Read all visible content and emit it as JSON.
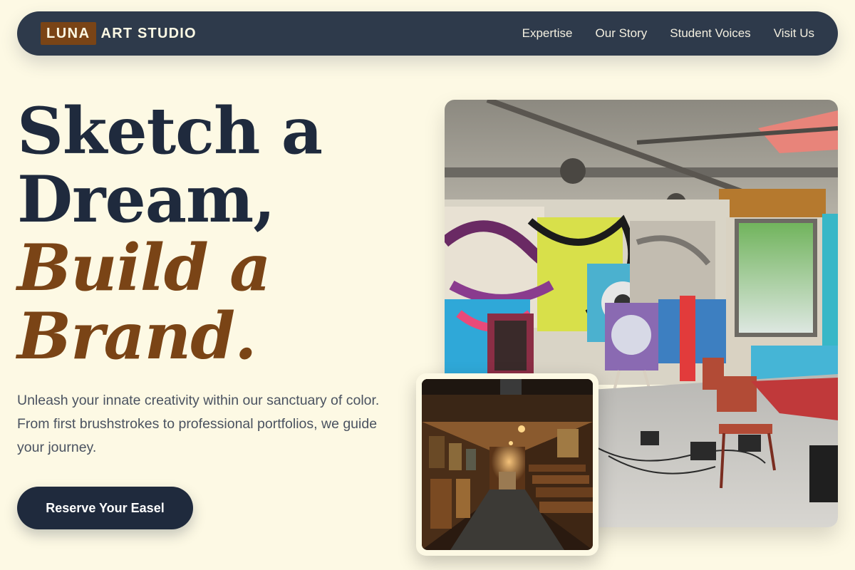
{
  "brand": {
    "logo_box": "LUNA",
    "logo_rest": "ART STUDIO"
  },
  "nav": {
    "items": [
      {
        "label": "Expertise"
      },
      {
        "label": "Our Story"
      },
      {
        "label": "Student Voices"
      },
      {
        "label": "Visit Us"
      }
    ]
  },
  "hero": {
    "line1": "Sketch a",
    "line2": "Dream,",
    "line3": "Build a",
    "line4": "Brand.",
    "description": "Unleash your innate creativity within our sanctuary of color. From first brushstrokes to professional portfolios, we guide your journey.",
    "cta_label": "Reserve Your Easel"
  },
  "images": {
    "main": "studio-graffiti-photo",
    "inset": "gallery-hallway-photo"
  },
  "colors": {
    "background": "#fdf9e4",
    "navy": "#1f2a3d",
    "nav_bar": "#2e3a4b",
    "accent_brown": "#7a4416"
  }
}
